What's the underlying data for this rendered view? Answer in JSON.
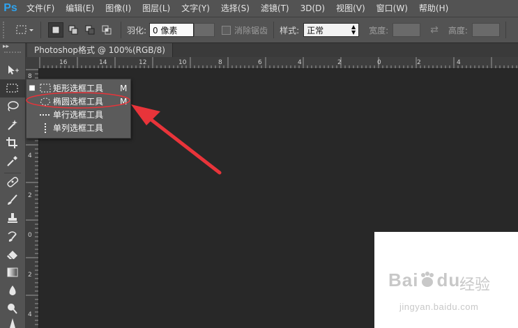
{
  "app": {
    "logo": "Ps"
  },
  "menu": [
    "文件(F)",
    "编辑(E)",
    "图像(I)",
    "图层(L)",
    "文字(Y)",
    "选择(S)",
    "滤镜(T)",
    "3D(D)",
    "视图(V)",
    "窗口(W)",
    "帮助(H)"
  ],
  "options": {
    "feather_label": "羽化:",
    "feather_value": "0 像素",
    "antialias_label": "消除锯齿",
    "style_label": "样式:",
    "style_value": "正常",
    "width_label": "宽度:",
    "height_label": "高度:"
  },
  "document": {
    "tab_title": "Photoshop格式 @ 100%(RGB/8)"
  },
  "ruler_h": [
    "16",
    "14",
    "12",
    "10",
    "8",
    "6",
    "4",
    "2",
    "0",
    "2",
    "4"
  ],
  "ruler_v": [
    "8",
    "6",
    "4",
    "2",
    "0",
    "2",
    "4"
  ],
  "flyout": {
    "items": [
      {
        "label": "矩形选框工具",
        "shortcut": "M",
        "selected": true,
        "icon": "rect-marquee-icon"
      },
      {
        "label": "椭圆选框工具",
        "shortcut": "M",
        "selected": false,
        "icon": "ellipse-marquee-icon"
      },
      {
        "label": "单行选框工具",
        "shortcut": "",
        "selected": false,
        "icon": "single-row-marquee-icon"
      },
      {
        "label": "单列选框工具",
        "shortcut": "",
        "selected": false,
        "icon": "single-column-marquee-icon"
      }
    ]
  },
  "watermark": {
    "brand": "Bai",
    "brand2": "du",
    "suffix": "经验",
    "url": "jingyan.baidu.com"
  },
  "colors": {
    "annotation_red": "#e8343a",
    "ps_blue": "#2fa3ee"
  }
}
